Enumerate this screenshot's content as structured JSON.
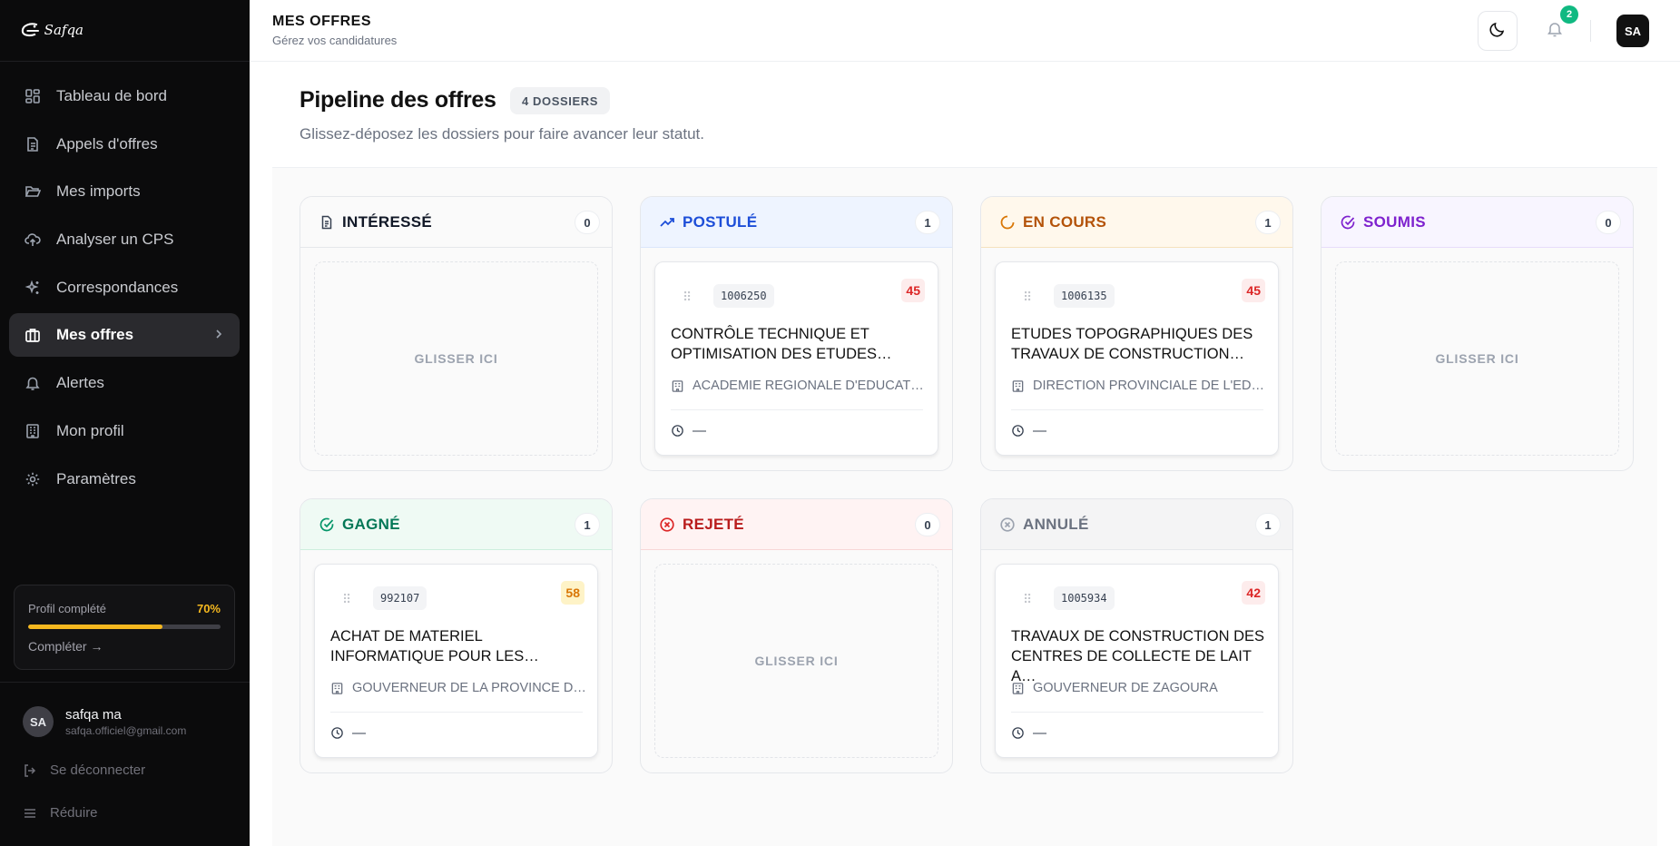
{
  "sidebar": {
    "brand": "Safqa",
    "items": [
      {
        "label": "Tableau de bord"
      },
      {
        "label": "Appels d'offres"
      },
      {
        "label": "Mes imports"
      },
      {
        "label": "Analyser un CPS"
      },
      {
        "label": "Correspondances"
      },
      {
        "label": "Mes offres"
      },
      {
        "label": "Alertes"
      },
      {
        "label": "Mon profil"
      },
      {
        "label": "Paramètres"
      }
    ],
    "profile": {
      "label": "Profil complété",
      "percent": "70%",
      "progress": 0.7,
      "link": "Compléter →"
    },
    "user": {
      "initials": "SA",
      "name": "safqa ma",
      "email": "safqa.officiel@gmail.com"
    },
    "logout": "Se déconnecter",
    "collapse": "Réduire"
  },
  "header": {
    "title": "MES OFFRES",
    "subtitle": "Gérez vos candidatures",
    "notifications": "2",
    "avatar": "SA"
  },
  "main": {
    "title": "Pipeline des offres",
    "count": "4 DOSSIERS",
    "subtitle": "Glissez-déposez les dossiers pour faire avancer leur statut.",
    "drop_label": "GLISSER ICI",
    "columns": [
      {
        "title": "INTÉRESSÉ",
        "count": "0",
        "color": "#111827"
      },
      {
        "title": "POSTULÉ",
        "count": "1",
        "color": "#1d4ed8",
        "card": {
          "ref": "1006250",
          "score": "45",
          "title": "CONTRÔLE TECHNIQUE ET OPTIMISATION DES ETUDES…",
          "org": "ACADEMIE REGIONALE D'EDUCATI…",
          "date": "—"
        }
      },
      {
        "title": "EN COURS",
        "count": "1",
        "color": "#b45309",
        "card": {
          "ref": "1006135",
          "score": "45",
          "title": "ETUDES TOPOGRAPHIQUES DES TRAVAUX DE CONSTRUCTION…",
          "org": "DIRECTION PROVINCIALE DE L'ED…",
          "date": "—"
        }
      },
      {
        "title": "SOUMIS",
        "count": "0",
        "color": "#7e22ce"
      },
      {
        "title": "GAGNÉ",
        "count": "1",
        "color": "#047857",
        "card": {
          "ref": "992107",
          "score": "58",
          "title": "ACHAT DE MATERIEL INFORMATIQUE POUR LES…",
          "org": "GOUVERNEUR DE LA PROVINCE D…",
          "date": "—"
        }
      },
      {
        "title": "REJETÉ",
        "count": "0",
        "color": "#b91c1c"
      },
      {
        "title": "ANNULÉ",
        "count": "1",
        "color": "#6b7280",
        "card": {
          "ref": "1005934",
          "score": "42",
          "title": "TRAVAUX DE CONSTRUCTION DES CENTRES DE COLLECTE DE LAIT A…",
          "org": "GOUVERNEUR DE ZAGOURA",
          "date": "—"
        }
      }
    ]
  }
}
